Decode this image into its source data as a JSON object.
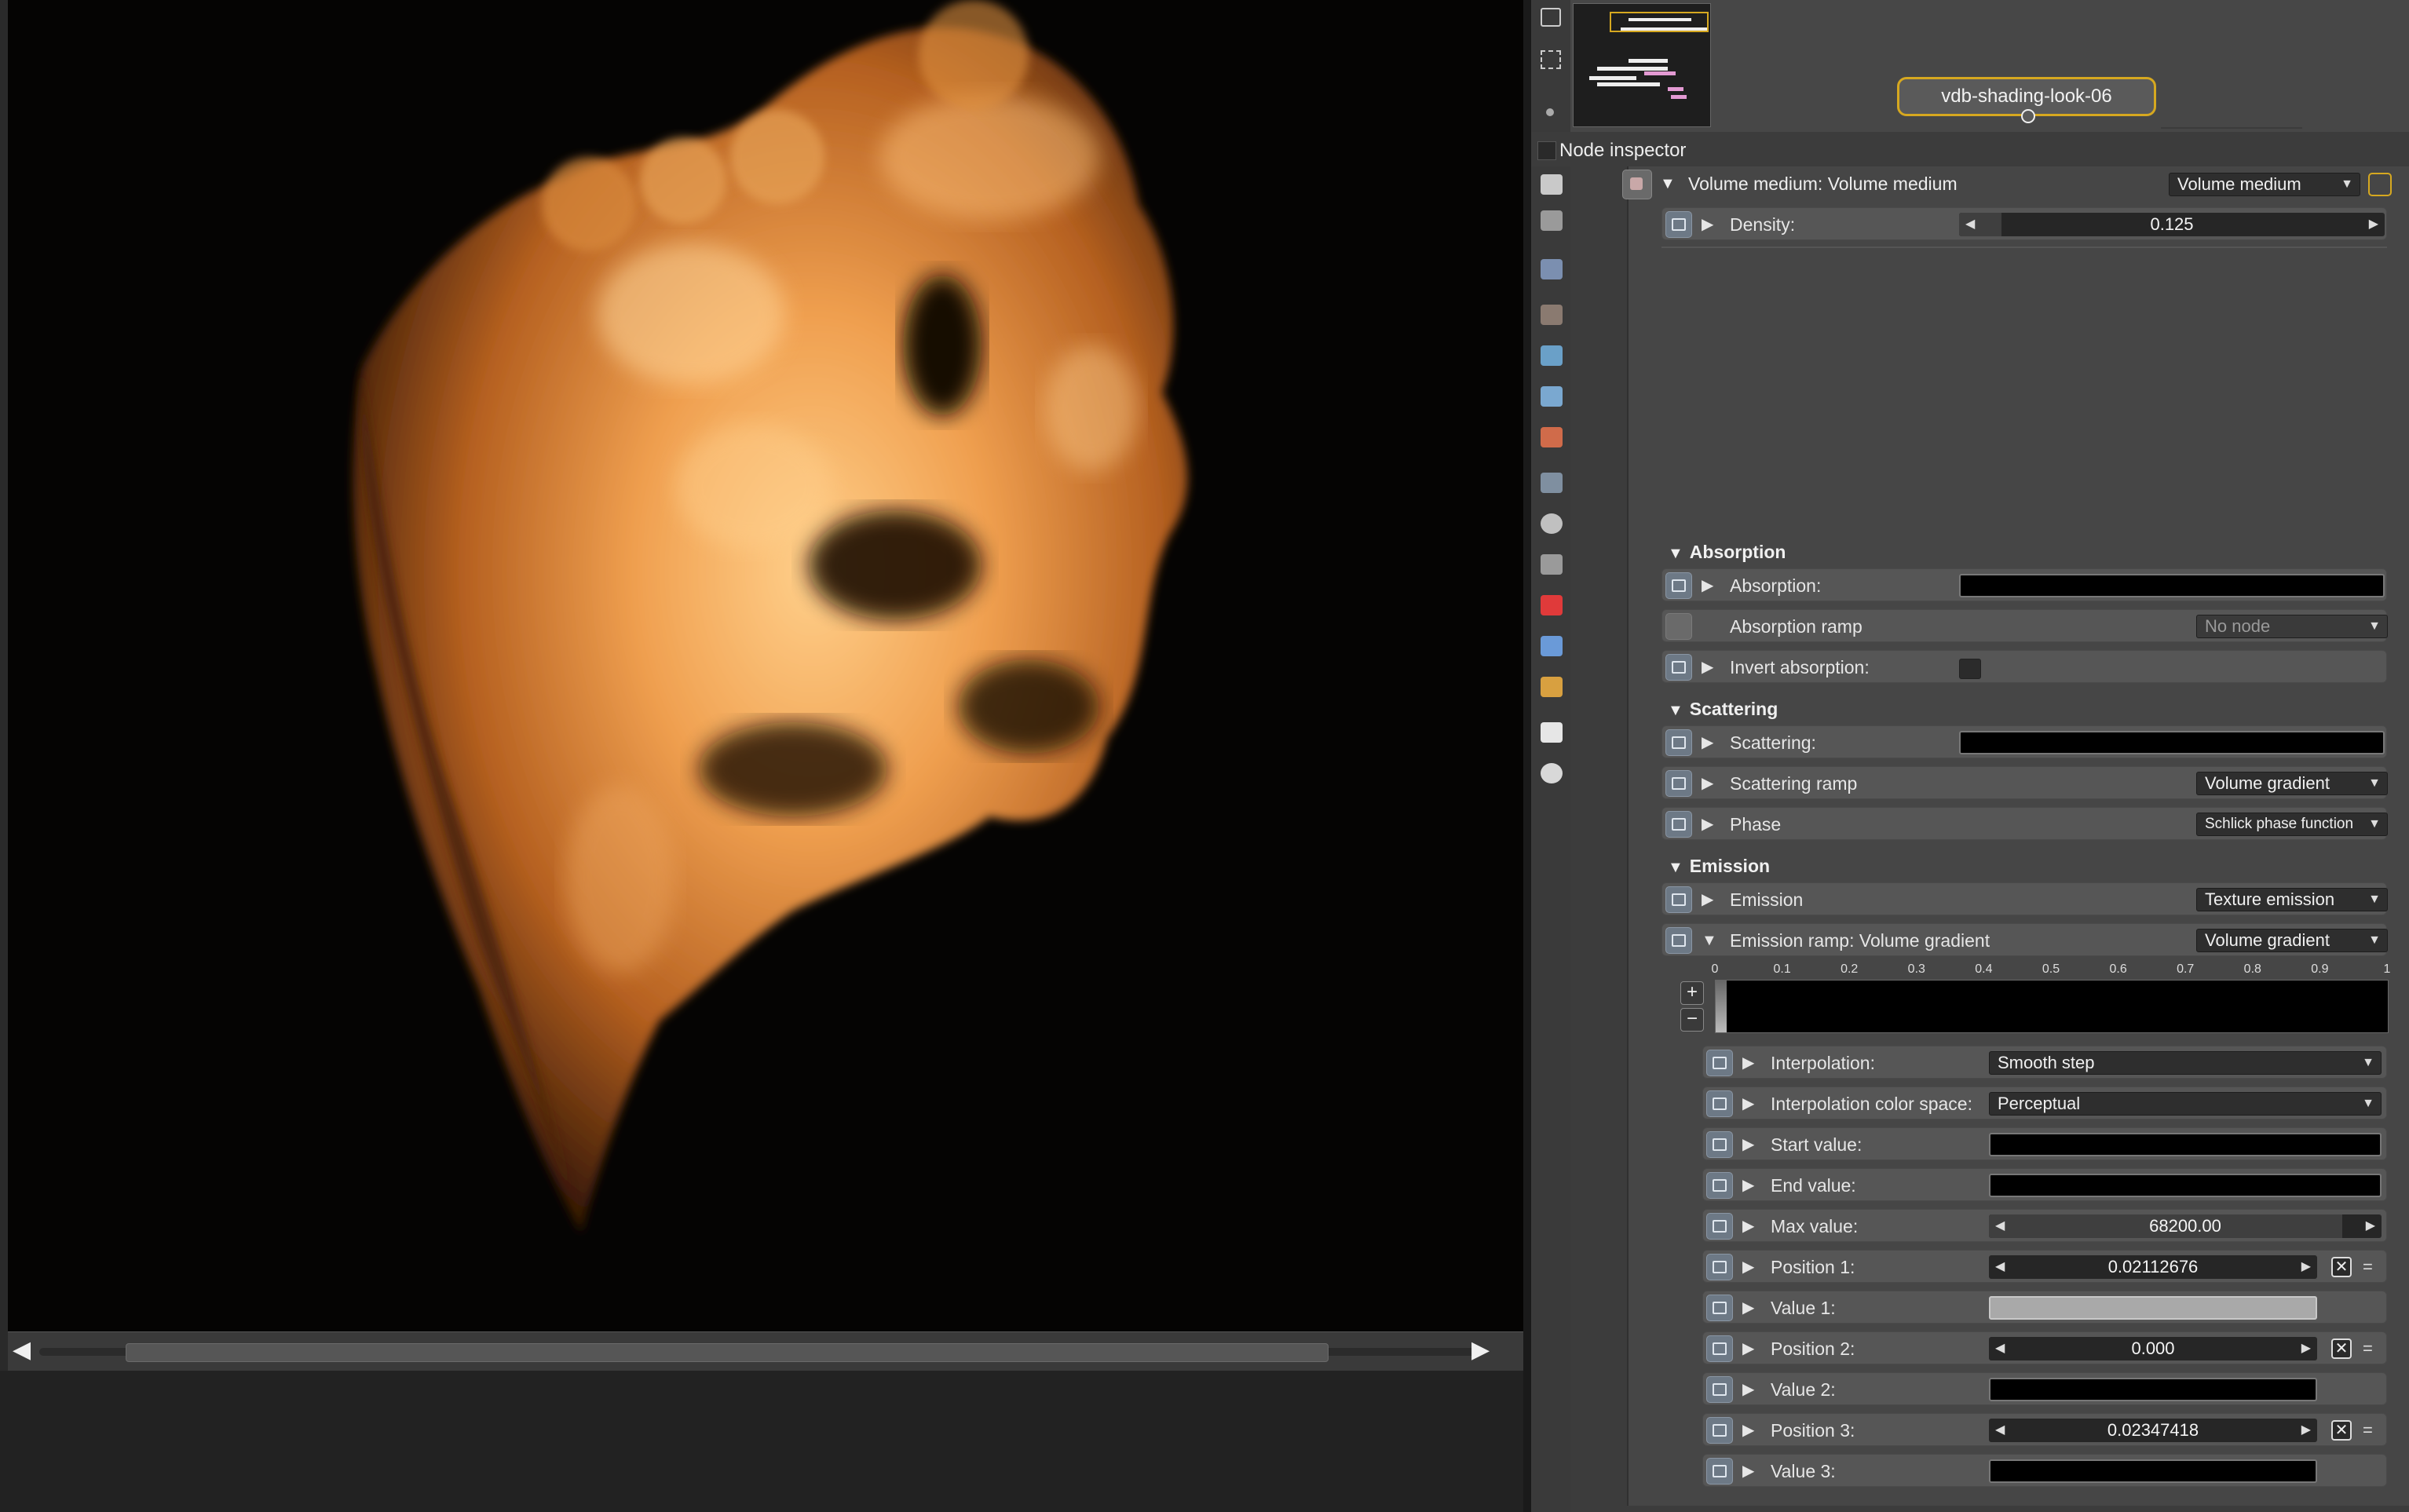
{
  "graph": {
    "node_label": "vdb-shading-look-06"
  },
  "inspector": {
    "title": "Node inspector",
    "node_header": {
      "label": "Volume medium: Volume medium",
      "type_value": "Volume medium"
    },
    "density": {
      "label": "Density:",
      "value": "0.125",
      "fraction": 0.1
    },
    "sections": {
      "absorption": "Absorption",
      "scattering": "Scattering",
      "emission": "Emission"
    },
    "absorption": {
      "absorption_label": "Absorption:",
      "ramp_label": "Absorption ramp",
      "ramp_value": "No node",
      "invert_label": "Invert absorption:"
    },
    "scattering": {
      "scattering_label": "Scattering:",
      "ramp_label": "Scattering ramp",
      "ramp_value": "Volume gradient",
      "phase_label": "Phase",
      "phase_value": "Schlick phase function"
    },
    "emission": {
      "emission_label": "Emission",
      "emission_value": "Texture emission",
      "ramp_label": "Emission ramp: Volume gradient",
      "ramp_value": "Volume gradient",
      "gradient_ticks": [
        "0",
        "0.1",
        "0.2",
        "0.3",
        "0.4",
        "0.5",
        "0.6",
        "0.7",
        "0.8",
        "0.9",
        "1"
      ],
      "interpolation_label": "Interpolation:",
      "interpolation_value": "Smooth step",
      "color_space_label": "Interpolation color space:",
      "color_space_value": "Perceptual",
      "start_label": "Start value:",
      "end_label": "End value:",
      "max_label": "Max value:",
      "max_value": "68200.00",
      "position1_label": "Position 1:",
      "position1_value": "0.02112676",
      "value1_label": "Value 1:",
      "position2_label": "Position 2:",
      "position2_value": "0.000",
      "value2_label": "Value 2:",
      "position3_label": "Position 3:",
      "position3_value": "0.02347418",
      "value3_label": "Value 3:"
    }
  }
}
